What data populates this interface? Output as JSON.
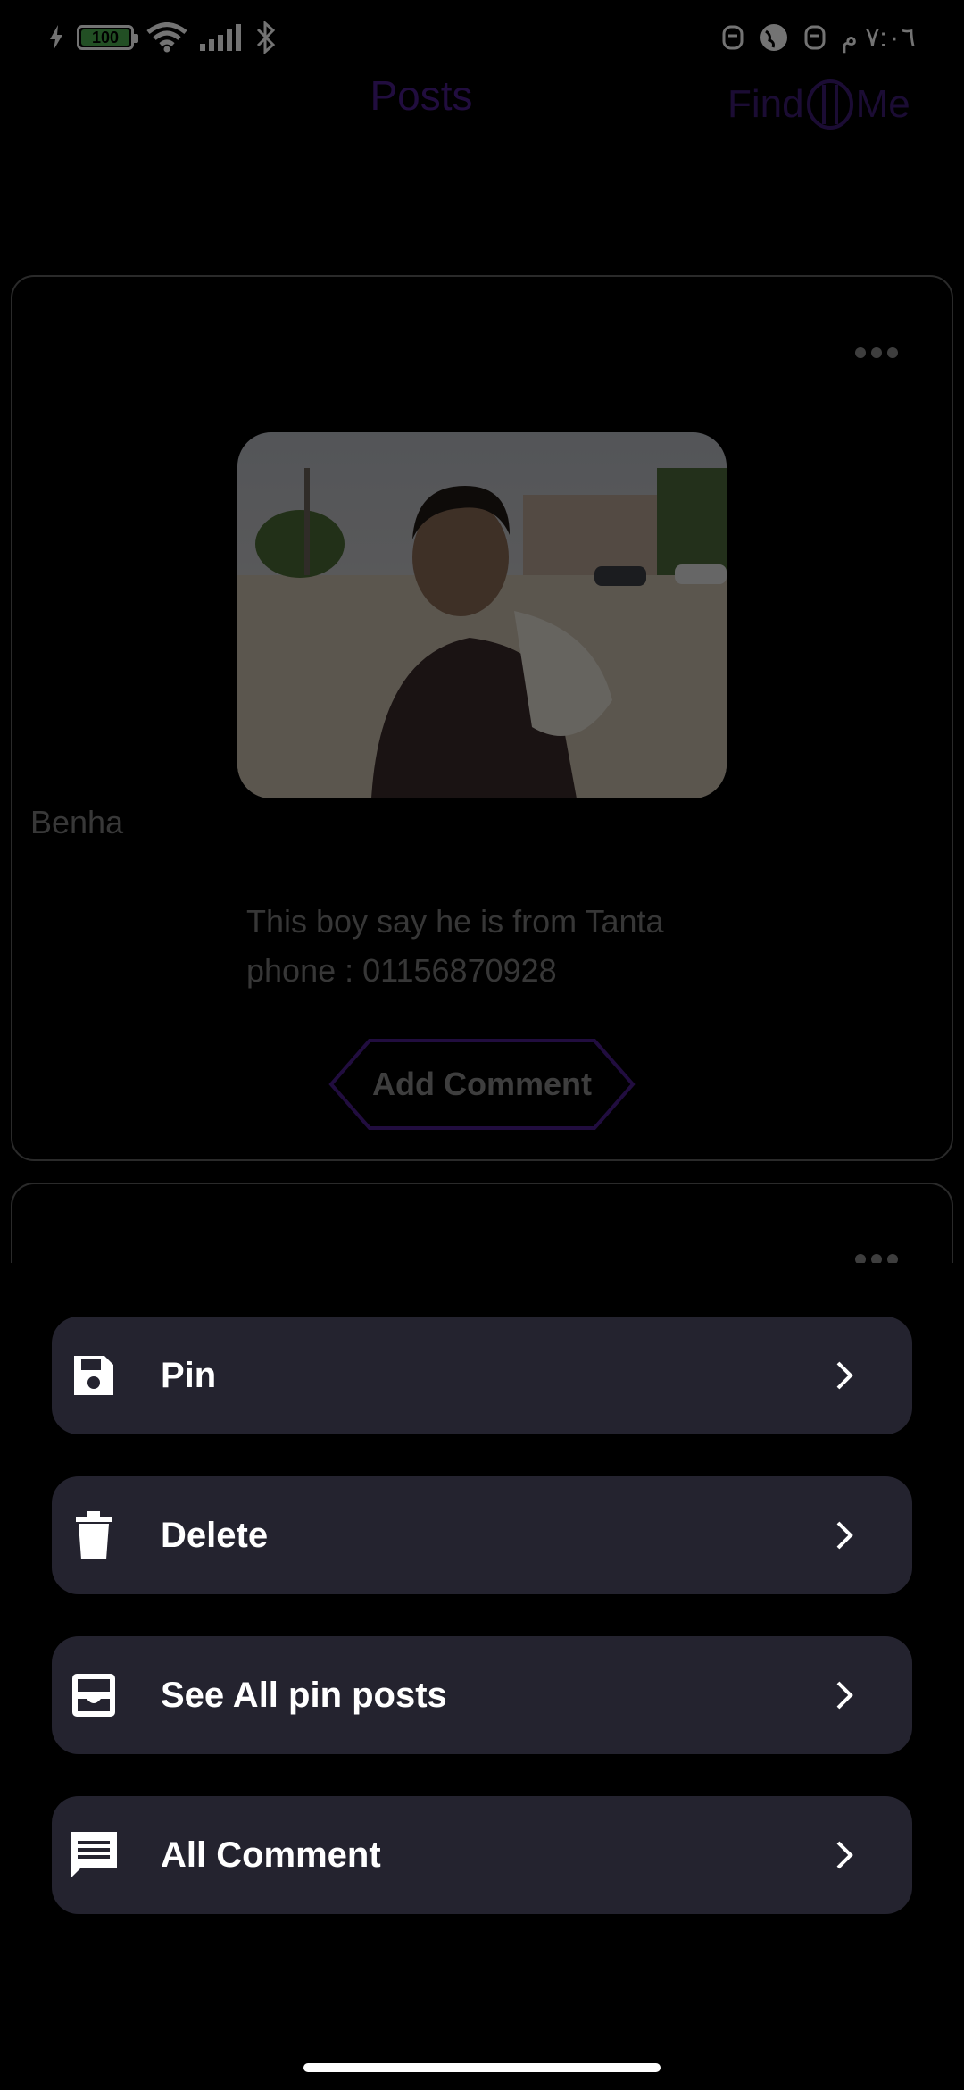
{
  "status_bar": {
    "battery": "100",
    "time": "٧:٠٦ م"
  },
  "app_bar": {
    "title": "Posts",
    "logo_left": "Find",
    "logo_right": "Me"
  },
  "post": {
    "location": "Benha",
    "description_line1": "This boy say he is from Tanta",
    "description_line2": "phone : 01156870928",
    "add_comment_label": "Add Comment",
    "image_icon": "photo-of-boy"
  },
  "sheet": {
    "options": [
      {
        "label": "Pin",
        "icon": "save-icon"
      },
      {
        "label": "Delete",
        "icon": "trash-icon"
      },
      {
        "label": "See All pin posts",
        "icon": "inbox-icon"
      },
      {
        "label": "All Comment",
        "icon": "comment-icon"
      }
    ]
  },
  "colors": {
    "accent": "#4b1e8c",
    "sheet_option_bg": "#24232f",
    "card_border": "#5e5e5e"
  }
}
